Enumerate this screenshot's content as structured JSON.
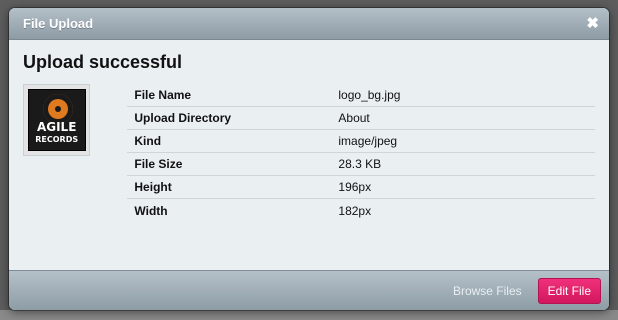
{
  "dialog": {
    "title": "File Upload",
    "close_icon": "close-icon",
    "heading": "Upload successful",
    "thumbnail": {
      "logo_text_line1": "AGILE",
      "logo_text_line2": "RECORDS"
    },
    "details": [
      {
        "label": "File Name",
        "value": "logo_bg.jpg"
      },
      {
        "label": "Upload Directory",
        "value": "About"
      },
      {
        "label": "Kind",
        "value": "image/jpeg"
      },
      {
        "label": "File Size",
        "value": "28.3 KB"
      },
      {
        "label": "Height",
        "value": "196px"
      },
      {
        "label": "Width",
        "value": "182px"
      }
    ],
    "footer": {
      "browse_label": "Browse Files",
      "edit_label": "Edit File"
    }
  },
  "colors": {
    "accent": "#e0246b",
    "header": "#a3b0b9",
    "body": "#eaeff2"
  }
}
